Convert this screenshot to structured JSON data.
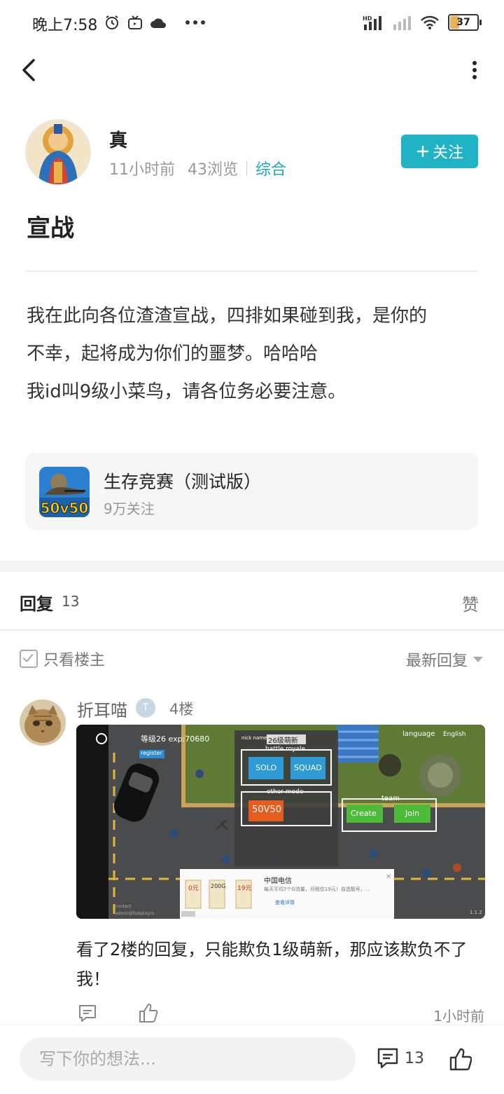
{
  "status_bar": {
    "time": "晚上7:58",
    "battery": "37",
    "net_label": "HD"
  },
  "author": {
    "name": "真",
    "time_ago": "11小时前",
    "views": "43浏览",
    "category": "综合",
    "follow_label": "关注"
  },
  "post": {
    "title": "宣战",
    "body_lines": [
      "我在此向各位渣渣宣战，四排如果碰到我，是你的",
      "不幸，起将成为你们的噩梦。哈哈哈",
      "我id叫9级小菜鸟，请各位务必要注意。"
    ]
  },
  "forum": {
    "name": "生存竞赛（测试版）",
    "followers": "9万关注",
    "icon_text": "50v50"
  },
  "replies_header": {
    "title": "回复",
    "count": "13",
    "likes_tab": "赞",
    "only_op": "只看楼主",
    "sort": "最新回复"
  },
  "reply": {
    "user": "折耳喵",
    "badge": "T",
    "floor": "4楼",
    "text": "看了2楼的回复，只能欺负1级萌新，那应该欺负不了我！",
    "time": "1小时前",
    "image": {
      "level_text": "等级26 exp:70680",
      "register": "register",
      "nick_label": "nick name",
      "nick_value": "26级萌新",
      "battle_royale": "battle royale",
      "solo": "SOLO",
      "squad": "SQUAD",
      "other_mode": "other mode",
      "mode_50v50": "50V50",
      "team": "team",
      "create": "Create",
      "join": "Join",
      "language": "language",
      "language_value": "English",
      "ad_title": "中国电信",
      "ad_desc": "每天平均7个G流量，月租仅19元！自选靓号，...",
      "ad_link": "查看详情",
      "ad_card1": "0元",
      "ad_card2": "200G",
      "ad_card3": "19元",
      "contact": "contact",
      "email": "admin@fastplay.io",
      "version": "1.1.2"
    }
  },
  "bottom_bar": {
    "input_placeholder": "写下你的想法...",
    "comment_count": "13"
  }
}
